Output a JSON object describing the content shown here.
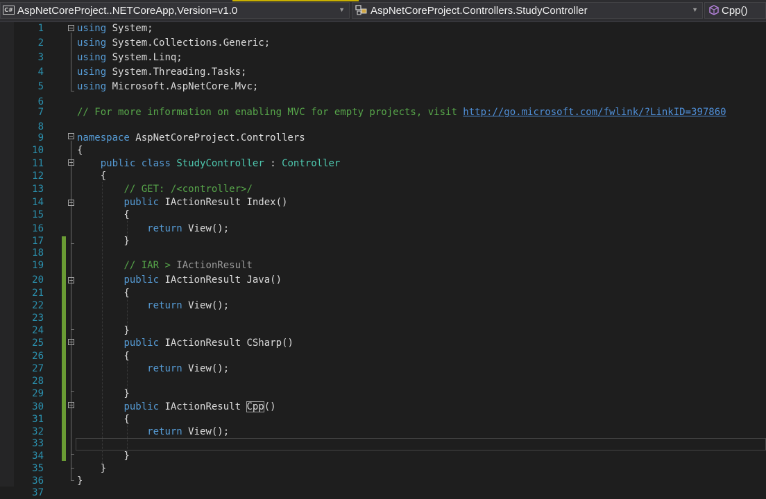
{
  "navbar": {
    "project_dropdown": "AspNetCoreProject..NETCoreApp,Version=v1.0",
    "type_dropdown": "AspNetCoreProject.Controllers.StudyController",
    "member_dropdown": "Cpp()",
    "project_icon_text": "C#",
    "icons": {
      "project": "csharp-project-icon",
      "type": "namespace-class-icon",
      "member": "method-cube-icon"
    },
    "accent_color": "#c9b000"
  },
  "editor": {
    "colors": {
      "keyword": "#569cd6",
      "type": "#4ec9b0",
      "comment": "#57a64a",
      "line_number": "#2b91af",
      "change_bar": "#6a9b34"
    },
    "lines": [
      {
        "n": "1",
        "segs": [
          {
            "c": "kw",
            "t": "using"
          },
          {
            "c": "",
            "t": " System;"
          }
        ]
      },
      {
        "n": "2",
        "segs": [
          {
            "c": "kw",
            "t": "using"
          },
          {
            "c": "",
            "t": " System.Collections.Generic;"
          }
        ]
      },
      {
        "n": "3",
        "segs": [
          {
            "c": "kw",
            "t": "using"
          },
          {
            "c": "",
            "t": " System.Linq;"
          }
        ]
      },
      {
        "n": "4",
        "segs": [
          {
            "c": "kw",
            "t": "using"
          },
          {
            "c": "",
            "t": " System.Threading.Tasks;"
          }
        ]
      },
      {
        "n": "5",
        "segs": [
          {
            "c": "kw",
            "t": "using"
          },
          {
            "c": "",
            "t": " Microsoft.AspNetCore.Mvc;"
          }
        ]
      },
      {
        "n": "6",
        "segs": []
      },
      {
        "n": "7",
        "segs": [
          {
            "c": "cm",
            "t": "// For more information on enabling MVC for empty projects, visit "
          },
          {
            "c": "link",
            "t": "http://go.microsoft.com/fwlink/?LinkID=397860"
          }
        ]
      },
      {
        "n": "8",
        "segs": []
      },
      {
        "n": "9",
        "segs": [
          {
            "c": "kw",
            "t": "namespace"
          },
          {
            "c": "",
            "t": " AspNetCoreProject.Controllers"
          }
        ]
      },
      {
        "n": "10",
        "segs": [
          {
            "c": "",
            "t": "{"
          }
        ]
      },
      {
        "n": "11",
        "segs": [
          {
            "c": "",
            "t": "    "
          },
          {
            "c": "kw",
            "t": "public"
          },
          {
            "c": "",
            "t": " "
          },
          {
            "c": "kw",
            "t": "class"
          },
          {
            "c": "",
            "t": " "
          },
          {
            "c": "ty",
            "t": "StudyController"
          },
          {
            "c": "",
            "t": " : "
          },
          {
            "c": "ty",
            "t": "Controller"
          }
        ]
      },
      {
        "n": "12",
        "segs": [
          {
            "c": "",
            "t": "    {"
          }
        ]
      },
      {
        "n": "13",
        "segs": [
          {
            "c": "",
            "t": "        "
          },
          {
            "c": "cm",
            "t": "// GET: /<controller>/"
          }
        ]
      },
      {
        "n": "14",
        "segs": [
          {
            "c": "",
            "t": "        "
          },
          {
            "c": "kw",
            "t": "public"
          },
          {
            "c": "",
            "t": " IActionResult Index()"
          }
        ]
      },
      {
        "n": "15",
        "segs": [
          {
            "c": "",
            "t": "        {"
          }
        ]
      },
      {
        "n": "16",
        "segs": [
          {
            "c": "",
            "t": "            "
          },
          {
            "c": "kw",
            "t": "return"
          },
          {
            "c": "",
            "t": " View();"
          }
        ]
      },
      {
        "n": "17",
        "segs": [
          {
            "c": "",
            "t": "        }"
          }
        ]
      },
      {
        "n": "18",
        "segs": []
      },
      {
        "n": "19",
        "segs": [
          {
            "c": "",
            "t": "        "
          },
          {
            "c": "cm",
            "t": "// IAR > "
          },
          {
            "c": "dim",
            "t": "IActionResult"
          }
        ]
      },
      {
        "n": "20",
        "segs": [
          {
            "c": "",
            "t": "        "
          },
          {
            "c": "kw",
            "t": "public"
          },
          {
            "c": "",
            "t": " IActionResult Java()"
          }
        ]
      },
      {
        "n": "21",
        "segs": [
          {
            "c": "",
            "t": "        {"
          }
        ]
      },
      {
        "n": "22",
        "segs": [
          {
            "c": "",
            "t": "            "
          },
          {
            "c": "kw",
            "t": "return"
          },
          {
            "c": "",
            "t": " View();"
          }
        ]
      },
      {
        "n": "23",
        "segs": []
      },
      {
        "n": "24",
        "segs": [
          {
            "c": "",
            "t": "        }"
          }
        ]
      },
      {
        "n": "25",
        "segs": [
          {
            "c": "",
            "t": "        "
          },
          {
            "c": "kw",
            "t": "public"
          },
          {
            "c": "",
            "t": " IActionResult CSharp()"
          }
        ]
      },
      {
        "n": "26",
        "segs": [
          {
            "c": "",
            "t": "        {"
          }
        ]
      },
      {
        "n": "27",
        "segs": [
          {
            "c": "",
            "t": "            "
          },
          {
            "c": "kw",
            "t": "return"
          },
          {
            "c": "",
            "t": " View();"
          }
        ]
      },
      {
        "n": "28",
        "segs": []
      },
      {
        "n": "29",
        "segs": [
          {
            "c": "",
            "t": "        }"
          }
        ]
      },
      {
        "n": "30",
        "segs": [
          {
            "c": "",
            "t": "        "
          },
          {
            "c": "kw",
            "t": "public"
          },
          {
            "c": "",
            "t": " IActionResult "
          },
          {
            "c": "boxed",
            "t": "Cpp"
          },
          {
            "c": "",
            "t": "()"
          }
        ]
      },
      {
        "n": "31",
        "segs": [
          {
            "c": "",
            "t": "        {"
          }
        ]
      },
      {
        "n": "32",
        "segs": [
          {
            "c": "",
            "t": "            "
          },
          {
            "c": "kw",
            "t": "return"
          },
          {
            "c": "",
            "t": " View();"
          }
        ]
      },
      {
        "n": "33",
        "segs": []
      },
      {
        "n": "34",
        "segs": [
          {
            "c": "",
            "t": "        }"
          }
        ]
      },
      {
        "n": "35",
        "segs": [
          {
            "c": "",
            "t": "    }"
          }
        ]
      },
      {
        "n": "36",
        "segs": [
          {
            "c": "",
            "t": "}"
          }
        ]
      },
      {
        "n": "37",
        "segs": []
      }
    ]
  }
}
